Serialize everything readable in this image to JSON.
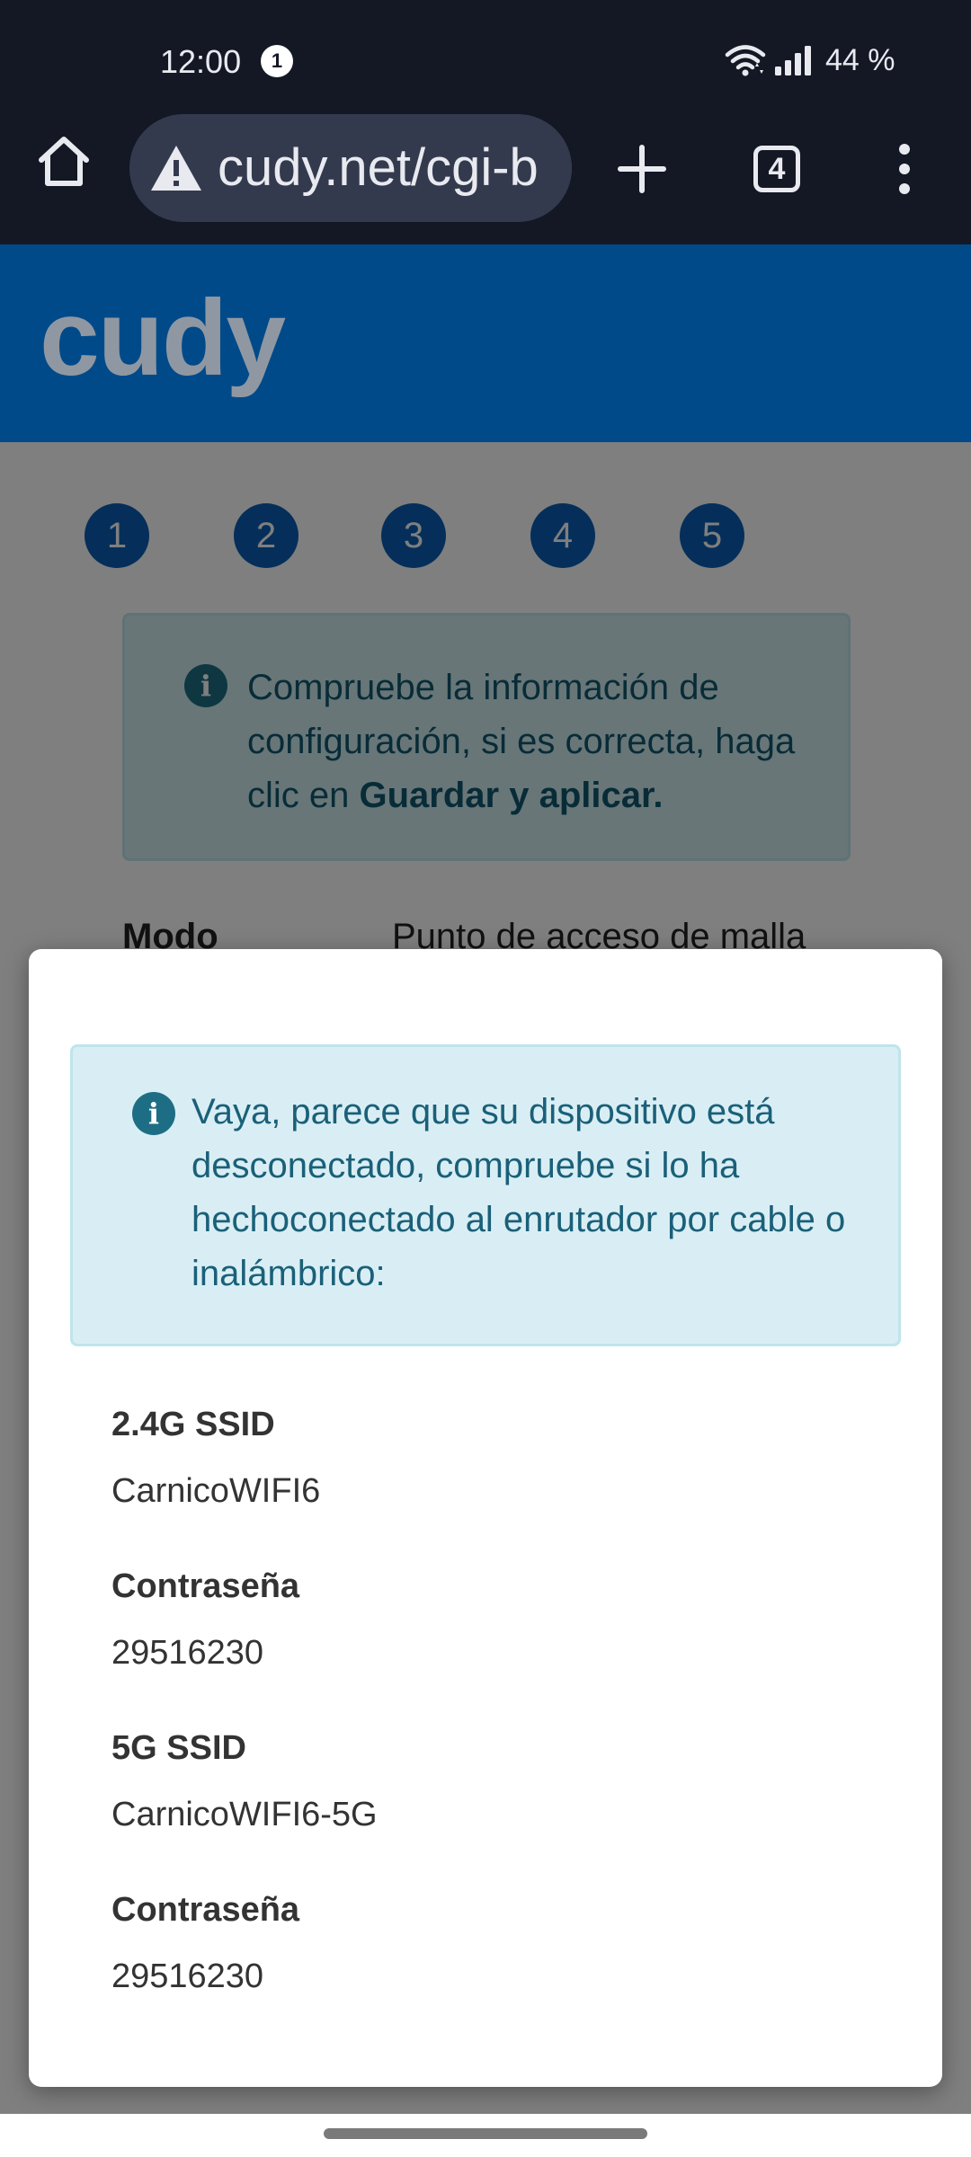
{
  "status_bar": {
    "time": "12:00",
    "notification_count": "1",
    "battery": "44 %"
  },
  "browser": {
    "url": "cudy.net/cgi-b",
    "tabs_count": "4"
  },
  "page": {
    "logo": "cudy",
    "steps": [
      "1",
      "2",
      "3",
      "4",
      "5"
    ],
    "info_icon": "i",
    "info_text": "Compruebe la información de configuración, si es correcta, haga clic en ",
    "info_text_bold": "Guardar y aplicar.",
    "mode_label": "Modo",
    "mode_value": "Punto de acceso de malla"
  },
  "modal": {
    "alert_icon": "i",
    "alert_text": "Vaya, parece que su dispositivo está desconectado, compruebe si lo ha hechoconectado al enrutador por cable o inalámbrico:",
    "fields": [
      {
        "label": "2.4G SSID",
        "value": "CarnicoWIFI6"
      },
      {
        "label": "Contraseña",
        "value": "29516230"
      },
      {
        "label": "5G SSID",
        "value": "CarnicoWIFI6-5G"
      },
      {
        "label": "Contraseña",
        "value": "29516230"
      }
    ]
  },
  "colors": {
    "status_bg": "#141824",
    "header_blue": "#004a8a",
    "step_blue": "#0a5fb4",
    "alert_bg": "#d9eef4",
    "alert_text": "#1a6079"
  },
  "icons": {
    "status": [
      "wifi-icon",
      "signal-icon"
    ],
    "toolbar": [
      "home-icon",
      "warning-icon",
      "plus-icon",
      "tabs-icon",
      "more-vert-icon"
    ],
    "content": [
      "info-icon"
    ]
  }
}
